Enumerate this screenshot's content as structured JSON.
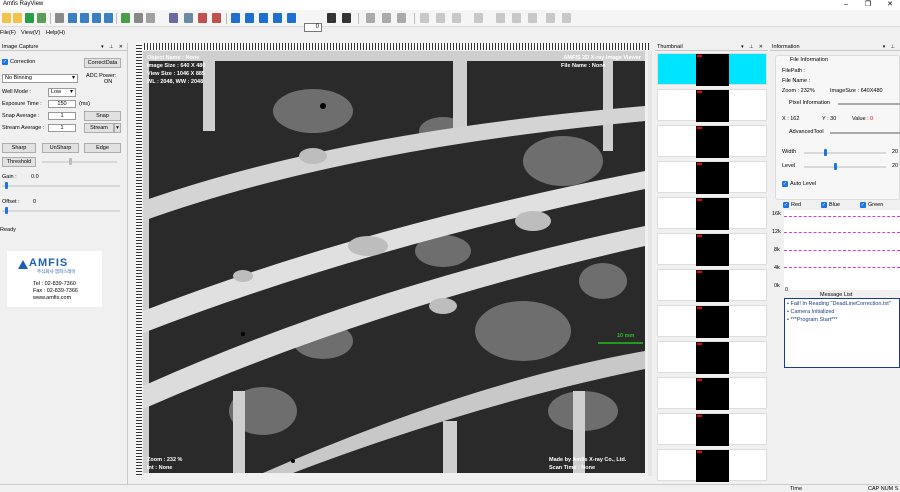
{
  "window": {
    "title": "Amfis RayView"
  },
  "menu": [
    "File(F)",
    "View(V)",
    "Help(H)"
  ],
  "toolbar": {
    "frame_value": "0",
    "colors": {
      "accent": "#1a73e8",
      "play_blue": "#1f6fd1"
    }
  },
  "image_capture": {
    "title": "Image Capture",
    "correction_label": "Correction",
    "correct_data_btn": "CorrectData",
    "binning_value": "No Binning",
    "adc_power_label": "ADC Power:",
    "adc_power_state": "ON",
    "well_mode_label": "Well Mode :",
    "well_mode_value": "Low",
    "exposure_label": "Exposure Time :",
    "exposure_value": "150",
    "exposure_unit": "(ms)",
    "snap_avg_label": "Snap Average :",
    "snap_avg_value": "1",
    "snap_btn": "Snap",
    "stream_avg_label": "Stream Average :",
    "stream_avg_value": "1",
    "stream_btn": "Stream",
    "sharp_btn": "Sharp",
    "unsharp_btn": "UnSharp",
    "edge_btn": "Edge",
    "threshold_btn": "Threshold",
    "gain_label": "Gain :",
    "gain_value": "0.0",
    "offset_label": "Offset :",
    "offset_value": "0",
    "status": "Ready"
  },
  "logo": {
    "brand": "AMFIS",
    "sub": "주식회사 엠피스레이",
    "tel": "Tel : 02-839-7360",
    "fax": "Fax : 02-839-7366",
    "web": "www.amfis.com"
  },
  "viewer": {
    "object_name": "Object Name : None",
    "image_size": "Image Size : 640 X 480",
    "view_size": "View Size : 1046 X 885",
    "wl_ww": "WL : 2048, WW : 2048",
    "app_name": "AMFIS 2D X-ray Image Viewer",
    "file_name": "File Name : None",
    "scale_bar": "10 mm",
    "zoom": "Zoom : 232 %",
    "int": "Int : None",
    "made_by": "Made by Amfis X-ray Co., Ltd.",
    "scan_time": "Scan Time : None"
  },
  "thumbnail": {
    "title": "Thumbnail",
    "rows": 12
  },
  "information": {
    "title": "Information",
    "file_info_label": "File Information",
    "file_path_label": "FilePath :",
    "file_name_label": "File Name :",
    "zoom_label": "Zoom : 232%",
    "image_size_label": "ImageSize : 640X480",
    "pixel_info_label": "Pixel Information",
    "x_label": "X : 162",
    "y_label": "Y : 30",
    "value_label": "Value :",
    "value_num": "0",
    "advanced_label": "AdvancedTool",
    "width_label": "Width",
    "width_value": "20",
    "level_label": "Level",
    "level_value": "20",
    "auto_level_label": "Auto Level",
    "red_label": "Red",
    "blue_label": "Blue",
    "green_label": "Green",
    "hist_ticks": [
      "16k",
      "12k",
      "8k",
      "4k",
      "0k"
    ],
    "hist_zero": "0"
  },
  "message_list": {
    "title": "Message List",
    "items": [
      "Fail! In Reading \"DeadLineCorrection.txt\"",
      "Camera Initialized",
      "***Program Start***"
    ]
  },
  "statusbar": {
    "time_label": "Time",
    "indicators": "CAP NUM S"
  }
}
